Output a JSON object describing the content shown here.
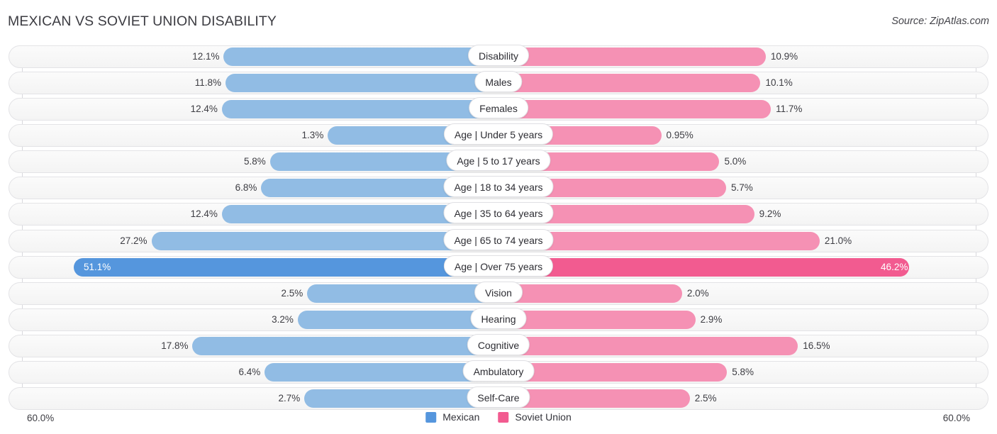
{
  "header": {
    "title": "MEXICAN VS SOVIET UNION DISABILITY",
    "source": "Source: ZipAtlas.com"
  },
  "axis": {
    "left_label": "60.0%",
    "right_label": "60.0%",
    "max": 60.0
  },
  "legend": {
    "items": [
      {
        "label": "Mexican",
        "color": "#5596dd"
      },
      {
        "label": "Soviet Union",
        "color": "#f25b90"
      }
    ]
  },
  "chart_data": {
    "type": "bar",
    "orientation": "diverging-horizontal",
    "title": "MEXICAN VS SOVIET UNION DISABILITY",
    "xlabel": "",
    "ylabel": "",
    "xlim": [
      60.0,
      60.0
    ],
    "grid": false,
    "legend_position": "bottom-center",
    "categories": [
      "Disability",
      "Males",
      "Females",
      "Age | Under 5 years",
      "Age | 5 to 17 years",
      "Age | 18 to 34 years",
      "Age | 35 to 64 years",
      "Age | 65 to 74 years",
      "Age | Over 75 years",
      "Vision",
      "Hearing",
      "Cognitive",
      "Ambulatory",
      "Self-Care"
    ],
    "series": [
      {
        "name": "Mexican",
        "color": "#91bce4",
        "values": [
          12.1,
          11.8,
          12.4,
          1.3,
          5.8,
          6.8,
          12.4,
          27.2,
          51.1,
          2.5,
          3.2,
          17.8,
          6.4,
          2.7
        ],
        "labels": [
          "12.1%",
          "11.8%",
          "12.4%",
          "1.3%",
          "5.8%",
          "6.8%",
          "12.4%",
          "27.2%",
          "51.1%",
          "2.5%",
          "3.2%",
          "17.8%",
          "6.4%",
          "2.7%"
        ]
      },
      {
        "name": "Soviet Union",
        "color": "#f591b4",
        "values": [
          10.9,
          10.1,
          11.7,
          0.95,
          5.0,
          5.7,
          9.2,
          21.0,
          46.2,
          2.0,
          2.9,
          16.5,
          5.8,
          2.5
        ],
        "labels": [
          "10.9%",
          "10.1%",
          "11.7%",
          "0.95%",
          "5.0%",
          "5.7%",
          "9.2%",
          "21.0%",
          "46.2%",
          "2.0%",
          "2.9%",
          "16.5%",
          "5.8%",
          "2.5%"
        ]
      }
    ],
    "highlight_row_index": 8
  },
  "rows": [
    {
      "label": "Disability",
      "left_label": "12.1%",
      "right_label": "10.9%",
      "left_value": 12.1,
      "right_value": 10.9,
      "highlight": false
    },
    {
      "label": "Males",
      "left_label": "11.8%",
      "right_label": "10.1%",
      "left_value": 11.8,
      "right_value": 10.1,
      "highlight": false
    },
    {
      "label": "Females",
      "left_label": "12.4%",
      "right_label": "11.7%",
      "left_value": 12.4,
      "right_value": 11.7,
      "highlight": false
    },
    {
      "label": "Age | Under 5 years",
      "left_label": "1.3%",
      "right_label": "0.95%",
      "left_value": 1.3,
      "right_value": 0.95,
      "highlight": false
    },
    {
      "label": "Age | 5 to 17 years",
      "left_label": "5.8%",
      "right_label": "5.0%",
      "left_value": 5.8,
      "right_value": 5.0,
      "highlight": false
    },
    {
      "label": "Age | 18 to 34 years",
      "left_label": "6.8%",
      "right_label": "5.7%",
      "left_value": 6.8,
      "right_value": 5.7,
      "highlight": false
    },
    {
      "label": "Age | 35 to 64 years",
      "left_label": "12.4%",
      "right_label": "9.2%",
      "left_value": 12.4,
      "right_value": 9.2,
      "highlight": false
    },
    {
      "label": "Age | 65 to 74 years",
      "left_label": "27.2%",
      "right_label": "21.0%",
      "left_value": 27.2,
      "right_value": 21.0,
      "highlight": false
    },
    {
      "label": "Age | Over 75 years",
      "left_label": "51.1%",
      "right_label": "46.2%",
      "left_value": 51.1,
      "right_value": 46.2,
      "highlight": true
    },
    {
      "label": "Vision",
      "left_label": "2.5%",
      "right_label": "2.0%",
      "left_value": 2.5,
      "right_value": 2.0,
      "highlight": false
    },
    {
      "label": "Hearing",
      "left_label": "3.2%",
      "right_label": "2.9%",
      "left_value": 3.2,
      "right_value": 2.9,
      "highlight": false
    },
    {
      "label": "Cognitive",
      "left_label": "17.8%",
      "right_label": "16.5%",
      "left_value": 17.8,
      "right_value": 16.5,
      "highlight": false
    },
    {
      "label": "Ambulatory",
      "left_label": "6.4%",
      "right_label": "5.8%",
      "left_value": 6.4,
      "right_value": 5.8,
      "highlight": false
    },
    {
      "label": "Self-Care",
      "left_label": "2.7%",
      "right_label": "2.5%",
      "left_value": 2.7,
      "right_value": 2.5,
      "highlight": false
    }
  ]
}
